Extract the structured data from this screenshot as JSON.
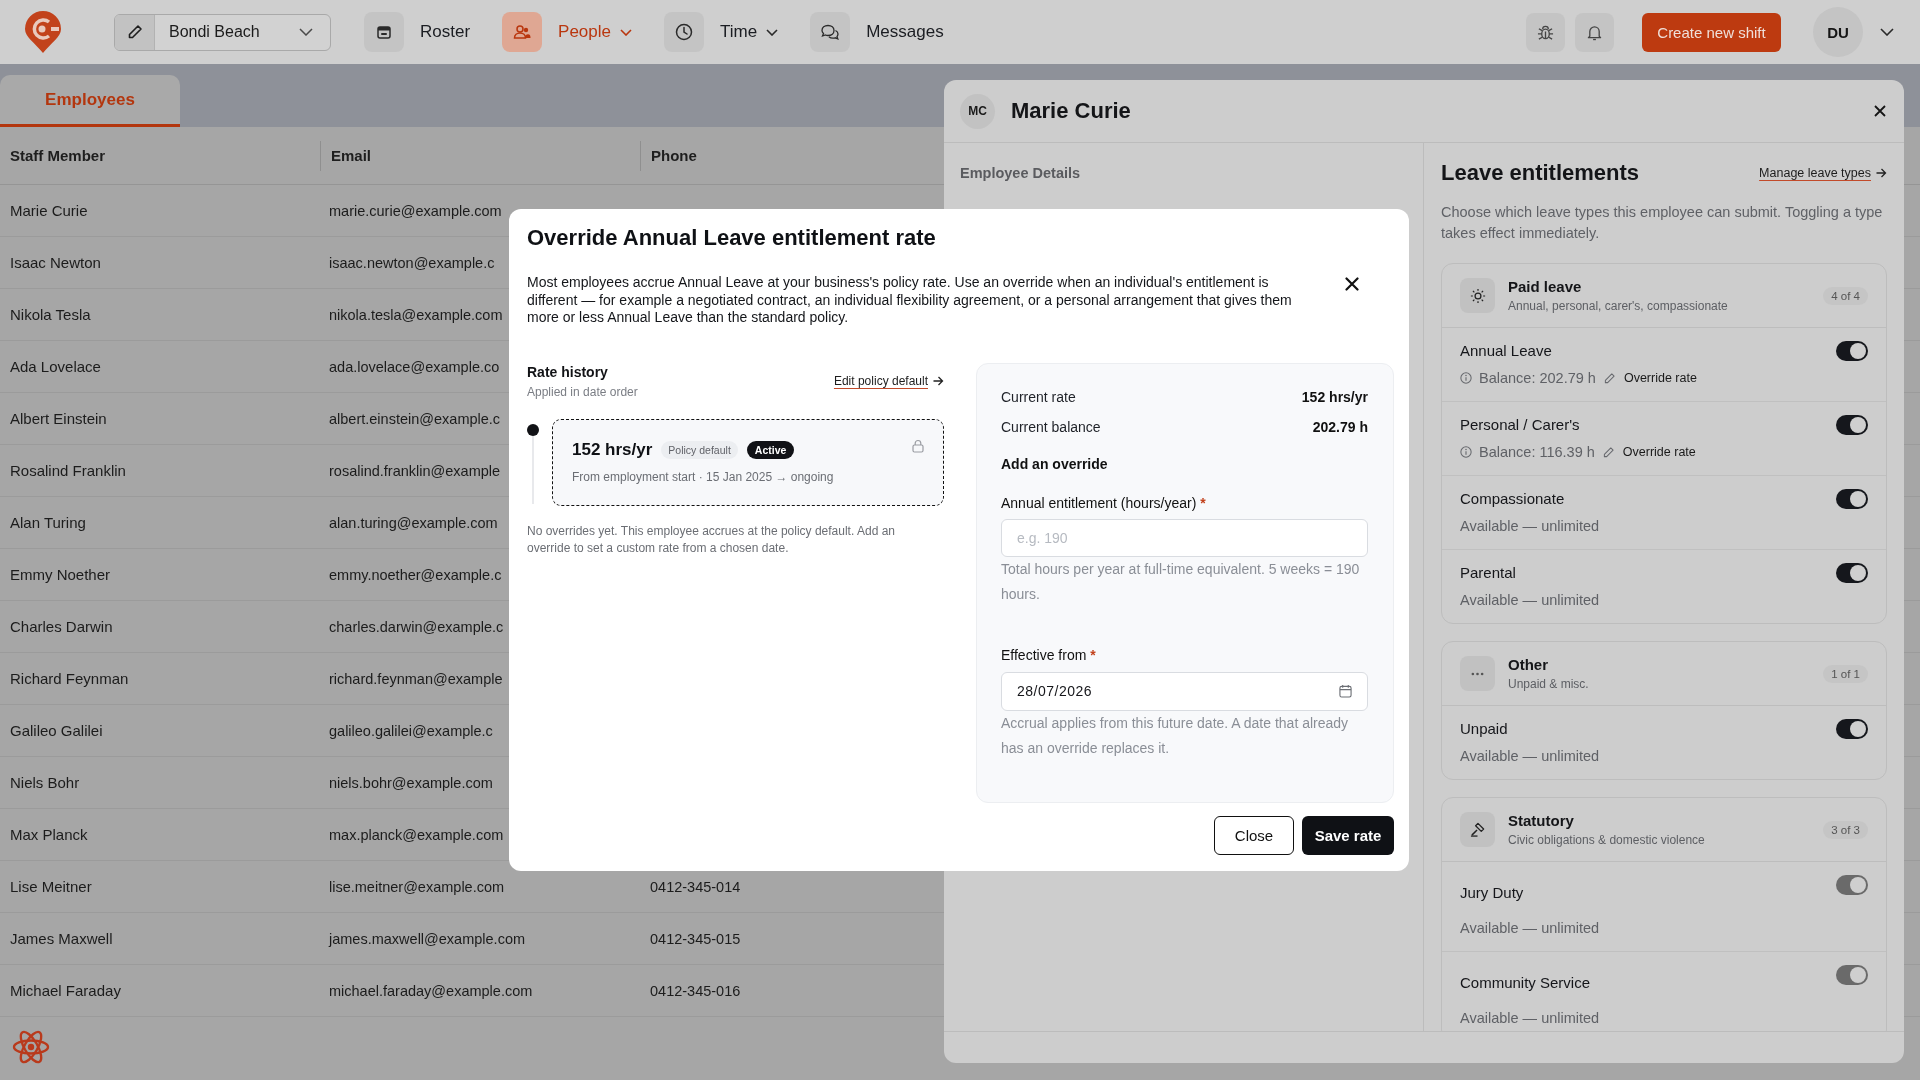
{
  "top_bar": {
    "location": "Bondi Beach",
    "nav": [
      {
        "label": "Roster",
        "selected": false,
        "menu": false
      },
      {
        "label": "People",
        "selected": true,
        "menu": true
      },
      {
        "label": "Time",
        "selected": false,
        "menu": true
      },
      {
        "label": "Messages",
        "selected": false,
        "menu": false
      }
    ],
    "create_button": "Create new shift",
    "avatar": "DU"
  },
  "tabs": [
    {
      "label": "Employees",
      "selected": true
    }
  ],
  "table": {
    "columns": [
      "Staff Member",
      "Email",
      "Phone"
    ],
    "rows": [
      {
        "name": "Marie Curie",
        "email": "marie.curie@example.com"
      },
      {
        "name": "Isaac Newton",
        "email": "isaac.newton@example.c"
      },
      {
        "name": "Nikola Tesla",
        "email": "nikola.tesla@example.com"
      },
      {
        "name": "Ada Lovelace",
        "email": "ada.lovelace@example.co"
      },
      {
        "name": "Albert Einstein",
        "email": "albert.einstein@example.c"
      },
      {
        "name": "Rosalind Franklin",
        "email": "rosalind.franklin@example"
      },
      {
        "name": "Alan Turing",
        "email": "alan.turing@example.com"
      },
      {
        "name": "Emmy Noether",
        "email": "emmy.noether@example.c"
      },
      {
        "name": "Charles Darwin",
        "email": "charles.darwin@example.c"
      },
      {
        "name": "Richard Feynman",
        "email": "richard.feynman@example"
      },
      {
        "name": "Galileo Galilei",
        "email": "galileo.galilei@example.c"
      },
      {
        "name": "Niels Bohr",
        "email": "niels.bohr@example.com"
      },
      {
        "name": "Max Planck",
        "email": "max.planck@example.com"
      },
      {
        "name": "Lise Meitner",
        "email": "lise.meitner@example.com",
        "phone": "0412-345-014"
      },
      {
        "name": "James Maxwell",
        "email": "james.maxwell@example.com",
        "phone": "0412-345-015"
      },
      {
        "name": "Michael Faraday",
        "email": "michael.faraday@example.com",
        "phone": "0412-345-016"
      }
    ]
  },
  "drawer": {
    "initials": "MC",
    "title": "Marie Curie",
    "details_heading": "Employee Details",
    "leave": {
      "title": "Leave entitlements",
      "link": "Manage leave types",
      "description": "Choose which leave types this employee can submit. Toggling a type takes effect immediately.",
      "groups": [
        {
          "title": "Paid leave",
          "subtitle": "Annual, personal, carer's, compassionate",
          "count": "4 of 4",
          "items": [
            {
              "name": "Annual Leave",
              "kind": "balance",
              "detail": "Balance: 202.79 h",
              "action": "Override rate",
              "on": true,
              "disabled": false
            },
            {
              "name": "Personal / Carer's",
              "kind": "balance",
              "detail": "Balance: 116.39 h",
              "action": "Override rate",
              "on": true,
              "disabled": false
            },
            {
              "name": "Compassionate",
              "kind": "plain",
              "detail": "Available — unlimited",
              "on": true,
              "disabled": false
            },
            {
              "name": "Parental",
              "kind": "plain",
              "detail": "Available — unlimited",
              "on": true,
              "disabled": false
            }
          ]
        },
        {
          "title": "Other",
          "subtitle": "Unpaid & misc.",
          "count": "1 of 1",
          "items": [
            {
              "name": "Unpaid",
              "kind": "plain",
              "detail": "Available — unlimited",
              "on": true,
              "disabled": false
            }
          ]
        },
        {
          "title": "Statutory",
          "subtitle": "Civic obligations & domestic violence",
          "count": "3 of 3",
          "items": [
            {
              "name": "Jury Duty",
              "kind": "plain",
              "detail": "Available — unlimited",
              "on": true,
              "disabled": true
            },
            {
              "name": "Community Service",
              "kind": "plain",
              "detail": "Available — unlimited",
              "on": true,
              "disabled": true
            }
          ]
        }
      ]
    }
  },
  "modal": {
    "title": "Override Annual Leave entitlement rate",
    "description": "Most employees accrue Annual Leave at your business's policy rate. Use an override when an individual's entitlement is different — for example a negotiated contract, an individual flexibility agreement, or a personal arrangement that gives them more or less Annual Leave than the standard policy.",
    "history": {
      "title": "Rate history",
      "subtitle": "Applied in date order",
      "link": "Edit policy default",
      "entries": [
        {
          "rate": "152 hrs/yr",
          "tag": "Policy default",
          "status": "Active",
          "range": "From employment start · 15 Jan 2025 → ongoing",
          "locked": true
        }
      ],
      "note": "No overrides yet. This employee accrues at the policy default. Add an override to set a custom rate from a chosen date."
    },
    "summary": [
      {
        "label": "Current rate",
        "value": "152 hrs/yr"
      },
      {
        "label": "Current balance",
        "value": "202.79 h"
      }
    ],
    "form": {
      "heading": "Add an override",
      "fields": [
        {
          "kind": "number",
          "label": "Annual entitlement (hours/year)",
          "required_mark": "*",
          "placeholder": "e.g. 190",
          "help": "Total hours per year at full-time equivalent. 5 weeks = 190 hours."
        },
        {
          "kind": "date",
          "label": "Effective from",
          "required_mark": "*",
          "value": "28/07/2026",
          "help": "Accrual applies from this future date. A date that already has an override replaces it."
        }
      ]
    },
    "buttons": [
      {
        "label": "Close",
        "kind": "secondary"
      },
      {
        "label": "Save rate",
        "kind": "primary"
      }
    ]
  }
}
